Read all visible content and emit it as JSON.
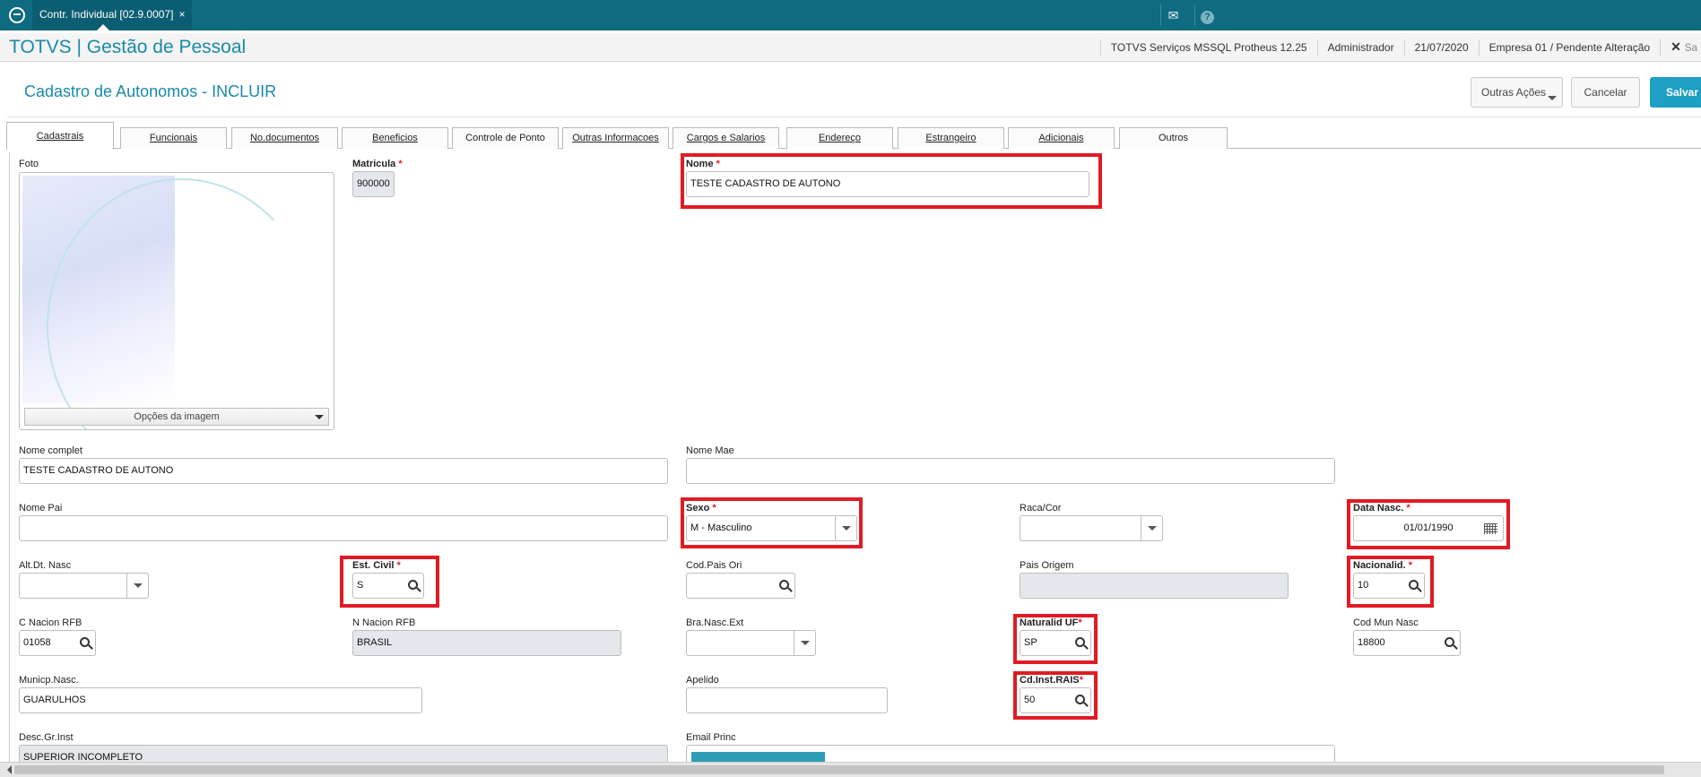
{
  "topbar": {
    "tab_label": "Contr. Individual [02.9.0007]",
    "tab_close": "×",
    "mail_icon": "✉",
    "help_icon": "?"
  },
  "header": {
    "title": "TOTVS | Gestão de Pessoal",
    "env": "TOTVS Serviços MSSQL Protheus 12.25",
    "user": "Administrador",
    "date": "21/07/2020",
    "company": "Empresa 01 / Pendente Alteração",
    "close": "✕",
    "extra": "Sa"
  },
  "page": {
    "title": "Cadastro de Autonomos - INCLUIR"
  },
  "actions": {
    "more": "Outras Ações",
    "cancel": "Cancelar",
    "save": "Salvar"
  },
  "tabs": [
    "Cadastrais",
    "Funcionais",
    "No.documentos",
    "Beneficios",
    "Controle de Ponto",
    "Outras Informacoes",
    "Cargos e Salarios",
    "Endereço",
    "Estrangeiro",
    "Adicionais",
    "Outros"
  ],
  "photo": {
    "label": "Foto",
    "options": "Opções da imagem"
  },
  "fields": {
    "matricula": {
      "label": "Matricula",
      "value": "900000"
    },
    "nome": {
      "label": "Nome",
      "value": "TESTE CADASTRO DE AUTONO"
    },
    "nome_complet": {
      "label": "Nome complet",
      "value": "TESTE CADASTRO DE AUTONO"
    },
    "nome_mae": {
      "label": "Nome Mae",
      "value": ""
    },
    "nome_pai": {
      "label": "Nome Pai",
      "value": ""
    },
    "sexo": {
      "label": "Sexo",
      "value": "M - Masculino"
    },
    "raca_cor": {
      "label": "Raca/Cor",
      "value": ""
    },
    "data_nasc": {
      "label": "Data Nasc.",
      "value": "01/01/1990"
    },
    "alt_dt_nasc": {
      "label": "Alt.Dt. Nasc",
      "value": ""
    },
    "est_civil": {
      "label": "Est. Civil",
      "value": "S"
    },
    "cod_pais_ori": {
      "label": "Cod.Pais Ori",
      "value": ""
    },
    "pais_origem": {
      "label": "Pais Origem",
      "value": ""
    },
    "nacionalid": {
      "label": "Nacionalid.",
      "value": "10"
    },
    "c_nacion_rfb": {
      "label": "C Nacion RFB",
      "value": "01058"
    },
    "n_nacion_rfb": {
      "label": "N Nacion RFB",
      "value": "BRASIL"
    },
    "bra_nasc_ext": {
      "label": "Bra.Nasc.Ext",
      "value": ""
    },
    "naturalid_uf": {
      "label": "Naturalid UF",
      "value": "SP"
    },
    "cod_mun_nasc": {
      "label": "Cod Mun Nasc",
      "value": "18800"
    },
    "municp_nasc": {
      "label": "Municp.Nasc.",
      "value": "GUARULHOS"
    },
    "apelido": {
      "label": "Apelido",
      "value": ""
    },
    "cd_inst_rais": {
      "label": "Cd.Inst.RAIS",
      "value": "50"
    },
    "desc_gr_inst": {
      "label": "Desc.Gr.Inst",
      "value": "SUPERIOR INCOMPLETO"
    },
    "email_princ": {
      "label": "Email Princ",
      "value": ""
    }
  },
  "required_mark": "*",
  "colors": {
    "topbar": "#0e6b80",
    "accent": "#1a89a8",
    "save": "#1d9ec3",
    "highlight": "#e01b24"
  }
}
